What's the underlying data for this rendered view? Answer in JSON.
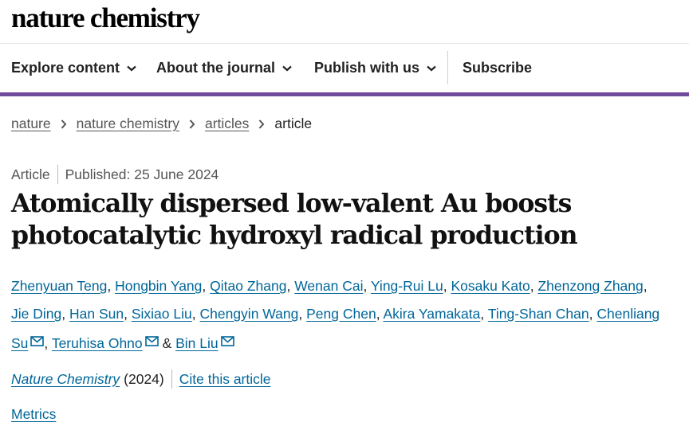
{
  "header": {
    "logo": "nature chemistry"
  },
  "nav": {
    "items": [
      {
        "label": "Explore content"
      },
      {
        "label": "About the journal"
      },
      {
        "label": "Publish with us"
      }
    ],
    "subscribe": "Subscribe",
    "accent_color": "#6f4c9b"
  },
  "breadcrumb": [
    "nature",
    "nature chemistry",
    "articles",
    "article"
  ],
  "article": {
    "type": "Article",
    "published": "Published: 25 June 2024",
    "title_line1": "Atomically dispersed low-valent Au boosts",
    "title_line2": "photocatalytic hydroxyl radical production",
    "authors": [
      "Zhenyuan Teng",
      "Hongbin Yang",
      "Qitao Zhang",
      "Wenan Cai",
      "Ying-Rui Lu",
      "Kosaku Kato",
      "Zhenzong Zhang",
      "Jie Ding",
      "Han Sun",
      "Sixiao Liu",
      "Chengyin Wang",
      "Peng Chen",
      "Akira Yamakata",
      "Ting-Shan Chan",
      "Chenliang Su",
      "Teruhisa Ohno",
      "Bin Liu"
    ],
    "author_sep": ",",
    "author_and": "&",
    "journal": "Nature Chemistry",
    "year": "(2024)",
    "cite_label": "Cite this article",
    "metrics_label": "Metrics",
    "link_color": "#006699"
  }
}
